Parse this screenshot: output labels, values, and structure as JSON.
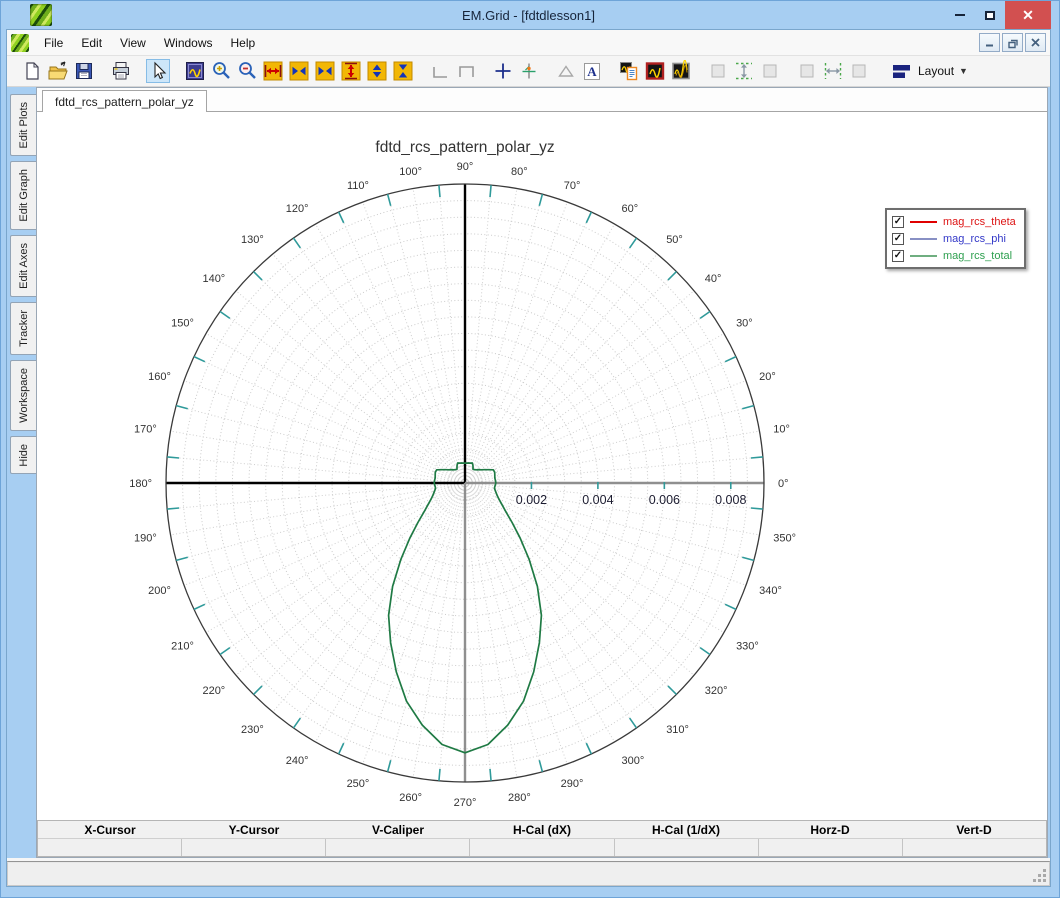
{
  "window": {
    "title": "EM.Grid - [fdtdlesson1]"
  },
  "menu": {
    "items": [
      "File",
      "Edit",
      "View",
      "Windows",
      "Help"
    ]
  },
  "toolbar": {
    "layout_label": "Layout",
    "buttons": [
      {
        "name": "new-file"
      },
      {
        "name": "open-file"
      },
      {
        "name": "save-file"
      },
      {
        "sep": true
      },
      {
        "name": "print"
      },
      {
        "sep": true
      },
      {
        "name": "select-cursor",
        "selected": true
      },
      {
        "sep": true
      },
      {
        "name": "plot-properties"
      },
      {
        "name": "zoom-in"
      },
      {
        "name": "zoom-out"
      },
      {
        "name": "expand-horizontal"
      },
      {
        "name": "fit-horizontal-out"
      },
      {
        "name": "fit-horizontal-in"
      },
      {
        "name": "expand-vertical"
      },
      {
        "name": "fit-vertical-out"
      },
      {
        "name": "fit-vertical-in"
      },
      {
        "sep": true
      },
      {
        "name": "corner-caliper-left",
        "disabled": true
      },
      {
        "name": "corner-caliper-top",
        "disabled": true
      },
      {
        "sep": true
      },
      {
        "name": "crosshair"
      },
      {
        "name": "tracker-cross"
      },
      {
        "sep": true
      },
      {
        "name": "caliper-triangle",
        "disabled": true
      },
      {
        "name": "text-label"
      },
      {
        "sep": true
      },
      {
        "name": "plot-report"
      },
      {
        "name": "plot-frame"
      },
      {
        "name": "plot-overlay"
      },
      {
        "sep": true
      },
      {
        "name": "box-left-a",
        "disabled": true
      },
      {
        "name": "fit-height",
        "disabled": true
      },
      {
        "name": "box-right-a",
        "disabled": true
      },
      {
        "sep": true
      },
      {
        "name": "box-left-b",
        "disabled": true
      },
      {
        "name": "fit-width",
        "disabled": true
      },
      {
        "name": "box-right-b",
        "disabled": true
      },
      {
        "sep": true
      },
      {
        "name": "layout",
        "label": "Layout",
        "dropdown": true
      }
    ]
  },
  "sidebar": {
    "tabs": [
      "Edit Plots",
      "Edit Graph",
      "Edit Axes",
      "Tracker",
      "Workspace",
      "Hide"
    ]
  },
  "document": {
    "tab": "fdtd_rcs_pattern_polar_yz"
  },
  "legend": {
    "items": [
      {
        "label": "mag_rcs_theta",
        "label_color": "#dd1414",
        "swatch_color": "#e00000",
        "checked": true
      },
      {
        "label": "mag_rcs_phi",
        "label_color": "#3338c8",
        "swatch_color": "#8890c4",
        "checked": true
      },
      {
        "label": "mag_rcs_total",
        "label_color": "#2fa050",
        "swatch_color": "#6fae80",
        "checked": true
      }
    ]
  },
  "tracker": {
    "columns": [
      "X-Cursor",
      "Y-Cursor",
      "V-Caliper",
      "H-Cal (dX)",
      "H-Cal (1/dX)",
      "Horz-D",
      "Vert-D"
    ],
    "values": [
      "",
      "",
      "",
      "",
      "",
      "",
      ""
    ]
  },
  "chart_data": {
    "type": "polar",
    "title": "fdtd_rcs_pattern_polar_yz",
    "angular_unit": "degrees",
    "angle_labels_deg": [
      0,
      10,
      20,
      30,
      40,
      50,
      60,
      70,
      80,
      90,
      100,
      110,
      120,
      130,
      140,
      150,
      160,
      170,
      180,
      190,
      200,
      210,
      220,
      230,
      240,
      250,
      260,
      270,
      280,
      290,
      300,
      310,
      320,
      330,
      340,
      350
    ],
    "outer_ticks_deg": [
      5,
      15,
      25,
      35,
      45,
      55,
      65,
      75,
      85,
      95,
      105,
      115,
      125,
      135,
      145,
      155,
      165,
      175,
      185,
      195,
      205,
      215,
      225,
      235,
      245,
      255,
      265,
      275,
      285,
      295,
      305,
      315,
      325,
      335,
      345,
      355
    ],
    "angular_grid_step_deg": 5,
    "radial_max": 0.009,
    "radial_grid_step": 0.0005,
    "radial_ticks": [
      {
        "value": 0.002,
        "label": "0.002"
      },
      {
        "value": 0.004,
        "label": "0.004"
      },
      {
        "value": 0.006,
        "label": "0.006"
      },
      {
        "value": 0.008,
        "label": "0.008"
      }
    ],
    "grid": true,
    "legend_position": "top-right",
    "series": [
      {
        "name": "mag_rcs_theta",
        "color": "#e00000",
        "visible_in_plot": false,
        "note": "checked in legend but magnitude ~0; no distinct curve visible"
      },
      {
        "name": "mag_rcs_phi",
        "color": "#8890c4",
        "visible_in_plot": false,
        "note": "checked in legend; curve coincides with mag_rcs_total / not separately visible"
      },
      {
        "name": "mag_rcs_total",
        "color": "#1f7a44",
        "visible_in_plot": true,
        "angles_deg": [
          0,
          5,
          10,
          15,
          20,
          25,
          30,
          35,
          40,
          45,
          50,
          55,
          60,
          65,
          70,
          75,
          80,
          85,
          90,
          95,
          100,
          105,
          110,
          115,
          120,
          125,
          130,
          135,
          140,
          145,
          150,
          155,
          160,
          165,
          170,
          175,
          180,
          185,
          190,
          195,
          200,
          205,
          210,
          215,
          220,
          225,
          230,
          235,
          240,
          245,
          250,
          255,
          260,
          265,
          270,
          275,
          280,
          285,
          290,
          295,
          300,
          305,
          310,
          315,
          320,
          325,
          330,
          335,
          340,
          345,
          350,
          355
        ],
        "r": [
          0.00093,
          0.00092,
          0.00091,
          0.00093,
          0.00095,
          0.00094,
          0.0008,
          0.0007,
          0.00062,
          0.00057,
          0.00052,
          0.00049,
          0.00048,
          0.00057,
          0.00064,
          0.00062,
          0.00061,
          0.0006,
          0.0006,
          0.0006,
          0.00061,
          0.00062,
          0.00064,
          0.00057,
          0.00048,
          0.00049,
          0.00052,
          0.00057,
          0.00062,
          0.0007,
          0.0008,
          0.00094,
          0.00095,
          0.00093,
          0.00091,
          0.00092,
          0.00093,
          0.00091,
          0.0009,
          0.00095,
          0.00102,
          0.00112,
          0.00128,
          0.0015,
          0.00185,
          0.00235,
          0.003,
          0.0038,
          0.0046,
          0.0053,
          0.00605,
          0.0068,
          0.0074,
          0.0079,
          0.00812,
          0.0079,
          0.0074,
          0.0068,
          0.00605,
          0.0053,
          0.0046,
          0.0038,
          0.003,
          0.00235,
          0.00185,
          0.0015,
          0.00128,
          0.00112,
          0.00102,
          0.00095,
          0.0009,
          0.00091
        ]
      }
    ]
  }
}
